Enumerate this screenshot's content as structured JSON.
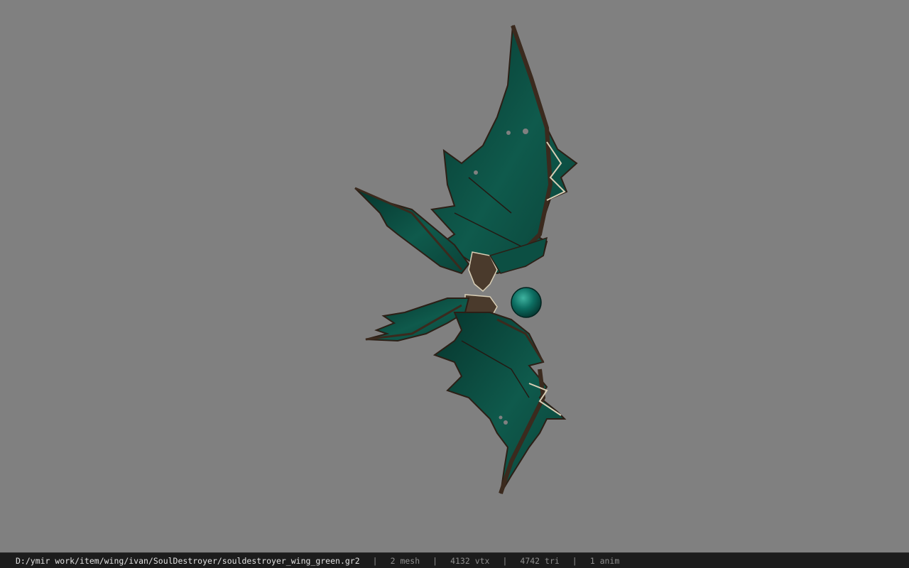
{
  "viewer": {
    "background_color": "#808080",
    "model": {
      "primary_color": "#0f5a4c",
      "edge_color": "#3b2a1e",
      "bone_color": "#d9cfb6",
      "orb_color": "#0d6e62"
    }
  },
  "statusbar": {
    "file_path": "D:/ymir work/item/wing/ivan/SoulDestroyer/souldestroyer_wing_green.gr2",
    "separator": "|",
    "mesh_count": "2 mesh",
    "vertex_count": "4132 vtx",
    "triangle_count": "4742 tri",
    "anim_count": "1 anim"
  }
}
